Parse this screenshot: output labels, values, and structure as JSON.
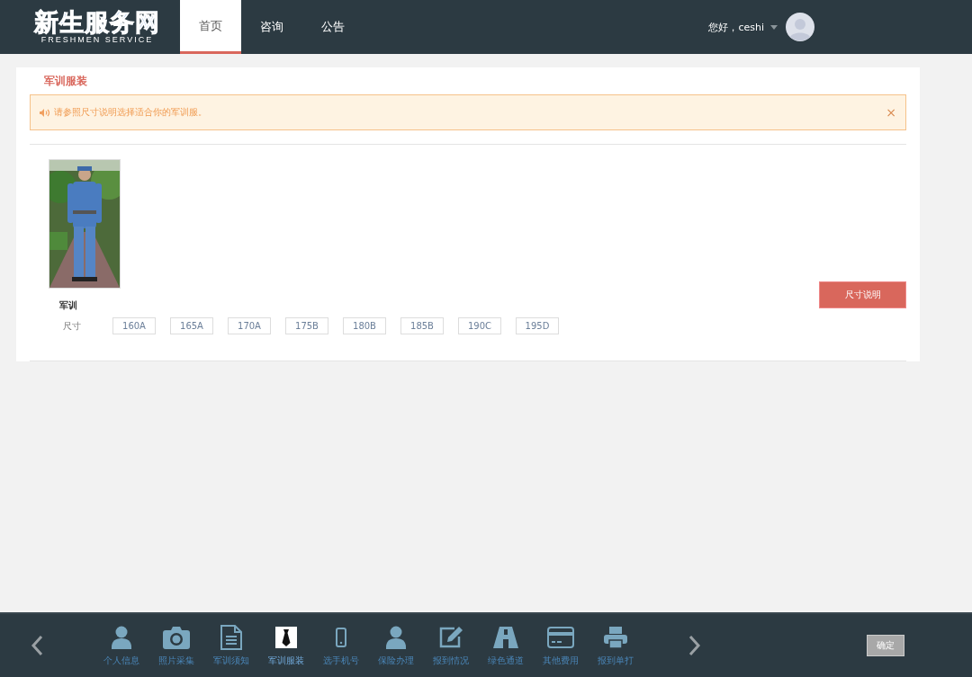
{
  "header": {
    "logo": {
      "title": "新生服务网",
      "subtitle": "FRESHMEN SERVICE"
    },
    "nav": [
      {
        "label": "首页",
        "selected": true
      },
      {
        "label": "咨询",
        "selected": false
      },
      {
        "label": "公告",
        "selected": false
      }
    ],
    "user": {
      "greeting": "您好，ceshi"
    }
  },
  "section": {
    "title": "军训服装",
    "alert": {
      "text": "请参照尺寸说明选择适合你的军训服。",
      "close": "×"
    },
    "item": {
      "name": "军训",
      "size_label": "尺寸",
      "sizes": [
        {
          "label": "160A",
          "selected": false
        },
        {
          "label": "165A",
          "selected": false
        },
        {
          "label": "170A",
          "selected": false
        },
        {
          "label": "175B",
          "selected": false
        },
        {
          "label": "180B",
          "selected": false
        },
        {
          "label": "185B",
          "selected": false
        },
        {
          "label": "190C",
          "selected": false
        },
        {
          "label": "195D",
          "selected": false
        }
      ]
    },
    "size_guide_button": "尺寸说明"
  },
  "footer": {
    "items": [
      {
        "kind": "person",
        "label": "个人信息",
        "selected": false
      },
      {
        "kind": "camera",
        "label": "照片采集",
        "selected": false
      },
      {
        "kind": "document",
        "label": "军训须知",
        "selected": false
      },
      {
        "kind": "tie",
        "label": "军训服装",
        "selected": true
      },
      {
        "kind": "phone",
        "label": "选手机号",
        "selected": false
      },
      {
        "kind": "person",
        "label": "保险办理",
        "selected": false
      },
      {
        "kind": "edit",
        "label": "报到情况",
        "selected": false
      },
      {
        "kind": "road",
        "label": "绿色通道",
        "selected": false
      },
      {
        "kind": "card",
        "label": "其他费用",
        "selected": false
      },
      {
        "kind": "printer",
        "label": "报到单打",
        "selected": false
      }
    ],
    "confirm_button": "确定"
  }
}
